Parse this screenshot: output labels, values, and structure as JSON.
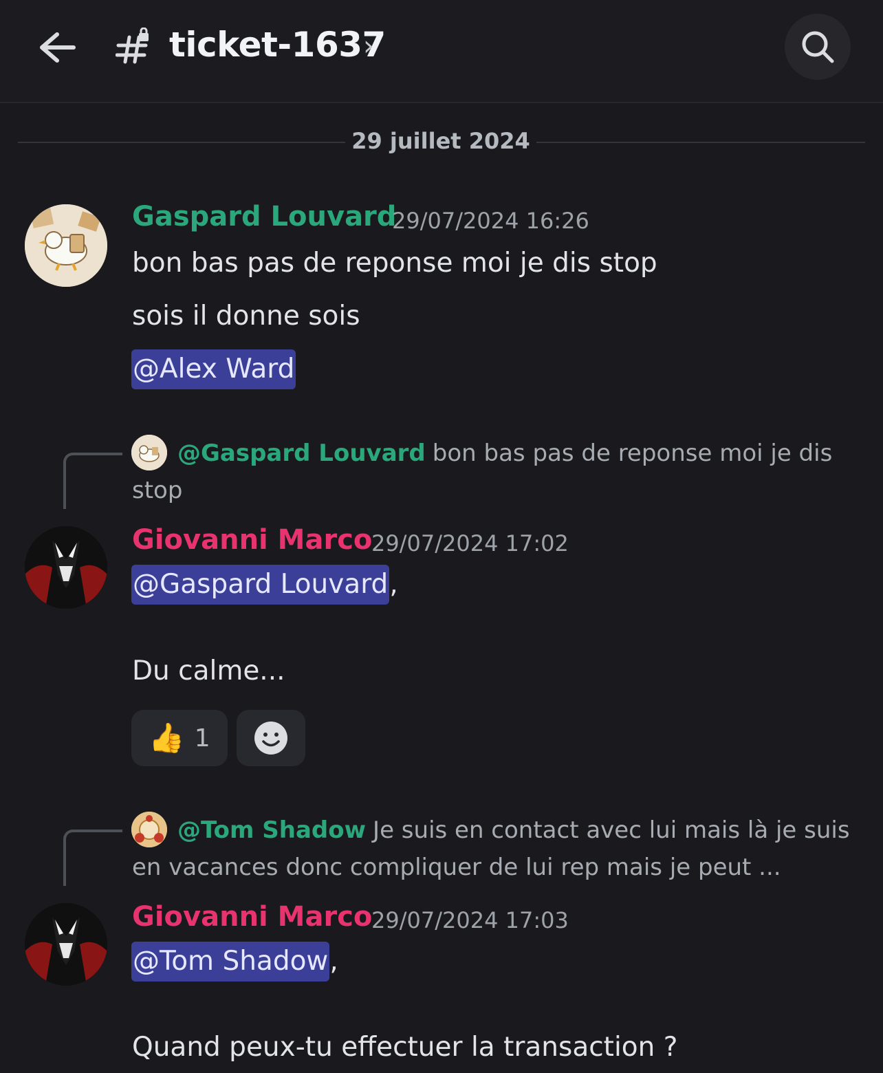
{
  "header": {
    "channel_name": "ticket-1637",
    "chevron": "›"
  },
  "divider": {
    "date": "29 juillet 2024"
  },
  "messages": [
    {
      "author": "Gaspard Louvard",
      "timestamp": "29/07/2024 16:26",
      "lines": [
        "bon bas pas de reponse moi je dis stop",
        "sois il donne sois"
      ],
      "mention": "@Alex Ward"
    },
    {
      "reply": {
        "author": "@Gaspard Louvard",
        "text": "bon bas pas de reponse moi je dis stop"
      },
      "author": "Giovanni Marco",
      "timestamp": "29/07/2024 17:02",
      "mention": "@Gaspard Louvard",
      "mention_suffix": ",",
      "body": "Du calme...",
      "reactions": [
        {
          "emoji": "👍",
          "count": "1"
        }
      ]
    },
    {
      "reply": {
        "author": "@Tom Shadow",
        "text": "Je suis en contact avec lui mais là je suis en vacances donc compliquer de lui rep mais je peut ..."
      },
      "author": "Giovanni Marco",
      "timestamp": "29/07/2024 17:03",
      "mention": "@Tom Shadow",
      "mention_suffix": ",",
      "body": "Quand peux-tu effectuer la transaction ?"
    }
  ],
  "colors": {
    "background": "#1a1a1e",
    "author_green": "#2aa87c",
    "author_pink": "#e8336f",
    "mention_bg": "#3c3f98"
  },
  "icons": {
    "back": "arrow-left-icon",
    "channel": "locked-hash-icon",
    "search": "magnifier-icon",
    "add_reaction": "smiley-add-icon"
  }
}
